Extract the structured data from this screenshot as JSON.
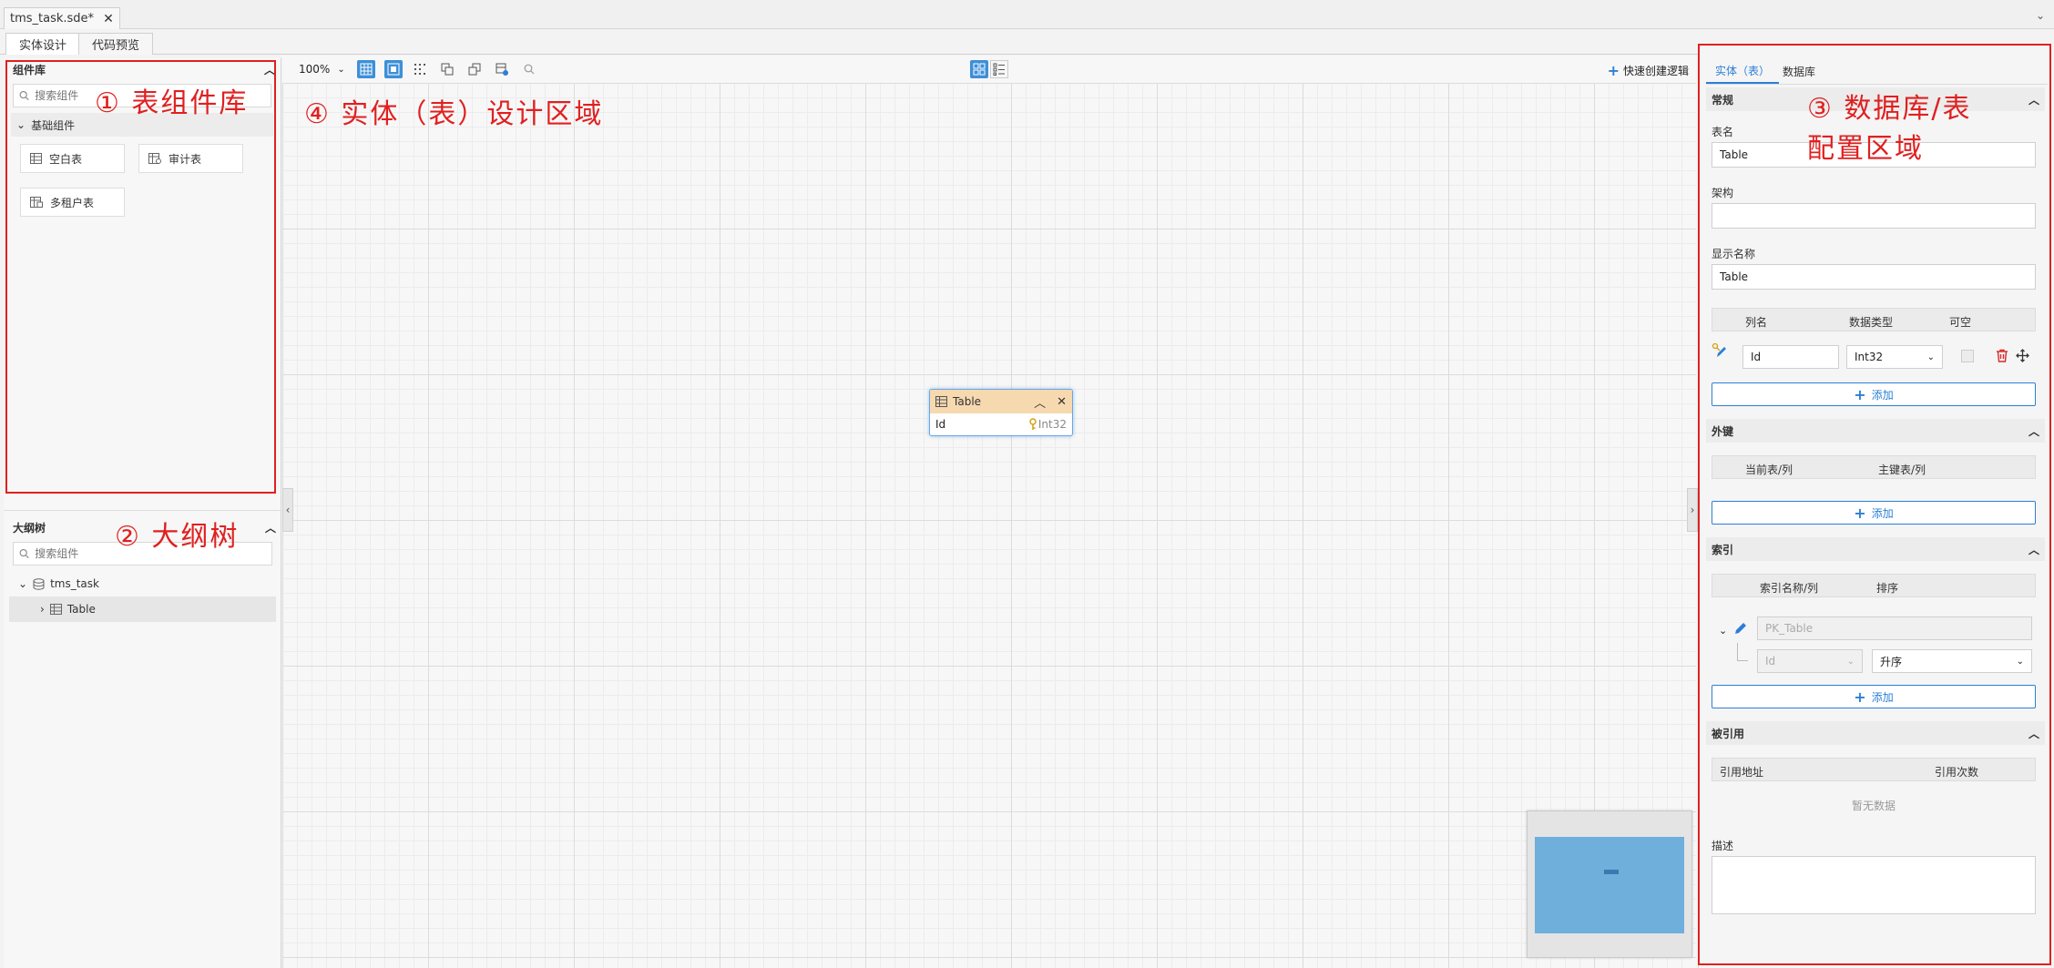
{
  "document_tab": {
    "title": "tms_task.sde*"
  },
  "view_tabs": [
    "实体设计",
    "代码预览"
  ],
  "left": {
    "library": {
      "title": "组件库",
      "search_placeholder": "搜索组件",
      "group": "基础组件",
      "components": [
        "空白表",
        "审计表",
        "多租户表"
      ]
    },
    "outline": {
      "title": "大纲树",
      "search_placeholder": "搜索组件",
      "root": "tms_task",
      "child": "Table"
    }
  },
  "toolbar": {
    "zoom": "100%",
    "quick_create": "快速创建逻辑"
  },
  "entity": {
    "name": "Table",
    "field_name": "Id",
    "field_type": "Int32"
  },
  "right": {
    "tabs": [
      "实体（表）",
      "数据库"
    ],
    "general": {
      "title": "常规",
      "table_name_label": "表名",
      "table_name": "Table",
      "schema_label": "架构",
      "schema": "",
      "display_name_label": "显示名称",
      "display_name": "Table",
      "columns_headers": [
        "列名",
        "数据类型",
        "可空"
      ],
      "column": {
        "name": "Id",
        "type": "Int32"
      },
      "add": "添加"
    },
    "foreign_keys": {
      "title": "外键",
      "headers": [
        "当前表/列",
        "主键表/列"
      ],
      "add": "添加"
    },
    "indexes": {
      "title": "索引",
      "headers": [
        "索引名称/列",
        "排序"
      ],
      "index_name": "PK_Table",
      "index_column": "Id",
      "order": "升序",
      "add": "添加"
    },
    "references": {
      "title": "被引用",
      "headers": [
        "引用地址",
        "引用次数"
      ],
      "empty": "暂无数据"
    },
    "description_label": "描述"
  },
  "annotations": [
    "① 表组件库",
    "② 大纲树",
    "③ 数据库/表",
    "配置区域",
    "④ 实体（表）设计区域"
  ],
  "colors": {
    "accent": "#2b7fd6",
    "annotation": "#e02020",
    "entity_header": "#f7d9b0",
    "minimap_view": "#6fafdc"
  }
}
